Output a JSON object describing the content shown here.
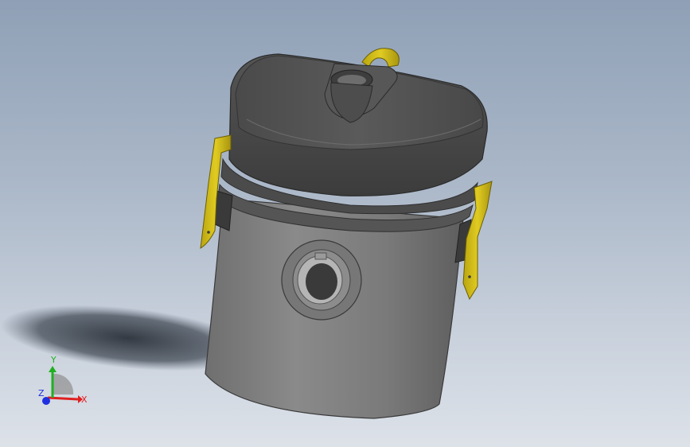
{
  "triad": {
    "x_label": "X",
    "y_label": "Y",
    "z_label": "Z",
    "x_color": "#e02020",
    "y_color": "#20b020",
    "z_color": "#2030e0"
  },
  "model": {
    "body_color": "#7d7d7d",
    "lid_color": "#4a4a4a",
    "clip_color": "#d8c21a",
    "shadow_color": "#333a44"
  }
}
